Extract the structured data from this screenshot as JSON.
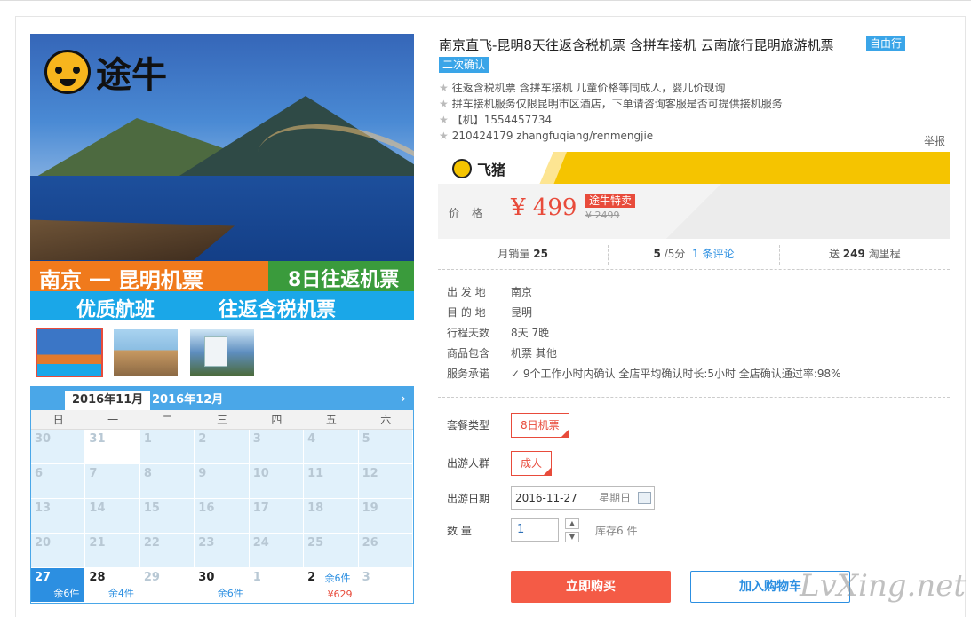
{
  "hero": {
    "logo_text": "途牛",
    "band1_left": "南京 一 昆明机票",
    "band1_right": "8日往返机票",
    "band2_left": "优质航班",
    "band2_right": "往返含税机票"
  },
  "calendar": {
    "tabs": [
      "2016年11月",
      "2016年12月"
    ],
    "next_icon": "›",
    "weekdays": [
      "日",
      "一",
      "二",
      "三",
      "四",
      "五",
      "六"
    ],
    "rows": [
      [
        "30",
        "31",
        "1",
        "2",
        "3",
        "4",
        "5"
      ],
      [
        "6",
        "7",
        "8",
        "9",
        "10",
        "11",
        "12"
      ],
      [
        "13",
        "14",
        "15",
        "16",
        "17",
        "18",
        "19"
      ],
      [
        "20",
        "21",
        "22",
        "23",
        "24",
        "25",
        "26"
      ],
      [
        "27",
        "28",
        "29",
        "30",
        "1",
        "2",
        "3"
      ]
    ],
    "labels": {
      "d27": "余6件",
      "d28": "余4件",
      "d30": "余6件",
      "d2_stock": "余6件",
      "d2_price": "¥629"
    }
  },
  "product": {
    "title": "南京直飞-昆明8天往返含税机票 含拼车接机 云南旅行昆明旅游机票",
    "tag_free": "自由行",
    "tag_confirm": "二次确认",
    "features": [
      "往返含税机票 含拼车接机 儿童价格等同成人，婴儿价现询",
      "拼车接机服务仅限昆明市区酒店，下单请咨询客服是否可提供接机服务",
      "【机】1554457734",
      "210424179 zhangfuqiang/renmengjie"
    ],
    "report": "举报"
  },
  "fliggy": {
    "logo": "飞猪"
  },
  "price": {
    "label": "价格",
    "value": "¥ 499",
    "special": "途牛特卖",
    "original": "¥ 2499"
  },
  "stats": {
    "monthly_label": "月销量",
    "monthly_value": "25",
    "rating": "5",
    "rating_suffix": "/5分",
    "reviews": "1 条评论",
    "points_prefix": "送",
    "points_value": "249",
    "points_suffix": "淘里程"
  },
  "info": [
    {
      "k": "出 发 地",
      "v": "南京"
    },
    {
      "k": "目 的 地",
      "v": "昆明"
    },
    {
      "k": "行程天数",
      "v": "8天 7晚"
    },
    {
      "k": "商品包含",
      "v": "机票  其他"
    },
    {
      "k": "服务承诺",
      "v": "✓ 9个工作小时内确认    全店平均确认时长:5小时    全店确认通过率:98%"
    }
  ],
  "options": {
    "package_label": "套餐类型",
    "package_value": "8日机票",
    "crowd_label": "出游人群",
    "crowd_value": "成人",
    "date_label": "出游日期",
    "date_value": "2016-11-27",
    "weekday": "星期日",
    "qty_label": "数    量",
    "qty_value": "1",
    "stock": "库存6 件",
    "buy": "立即购买",
    "cart": "加入购物车"
  },
  "watermark": "LvXing.net"
}
